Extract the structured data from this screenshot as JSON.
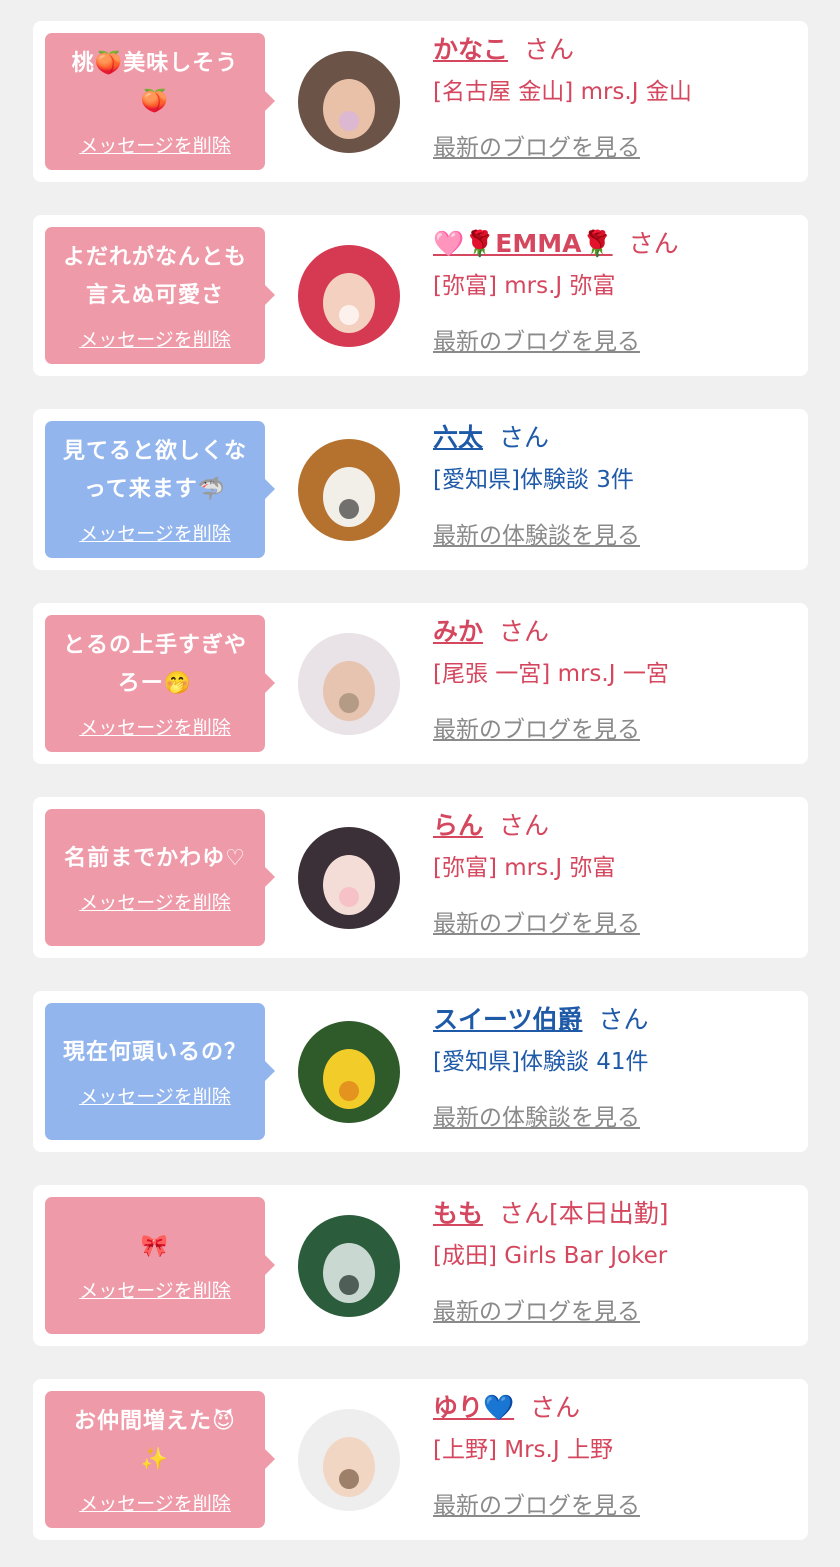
{
  "entries": [
    {
      "message": "桃🍑美味しそう\n🍑",
      "delete_label": "メッセージを削除",
      "name": "かなこ",
      "suffix": "さん",
      "subtitle": "[名古屋 金山] mrs.J 金山",
      "link_label": "最新のブログを見る",
      "variant": "pink",
      "avatar": {
        "bg": "#6b5347",
        "fg": "#e8c1a8",
        "accent": "#d9b3e6"
      }
    },
    {
      "message": "よだれがなんとも\n言えぬ可愛さ",
      "delete_label": "メッセージを削除",
      "name": "🩷🌹EMMA🌹",
      "suffix": "さん",
      "subtitle": "[弥富] mrs.J 弥富",
      "link_label": "最新のブログを見る",
      "variant": "pink",
      "avatar": {
        "bg": "#d63a52",
        "fg": "#f3d0c0",
        "accent": "#ffffff"
      }
    },
    {
      "message": "見てると欲しくな\nって来ます🦈",
      "delete_label": "メッセージを削除",
      "name": "六太",
      "suffix": "さん",
      "subtitle": "[愛知県]体験談 3件",
      "link_label": "最新の体験談を見る",
      "variant": "blue",
      "avatar": {
        "bg": "#b5722f",
        "fg": "#f2efe8",
        "accent": "#3a3a3a"
      }
    },
    {
      "message": "とるの上手すぎや\nろー🤭",
      "delete_label": "メッセージを削除",
      "name": "みか",
      "suffix": "さん",
      "subtitle": "[尾張 一宮] mrs.J 一宮",
      "link_label": "最新のブログを見る",
      "variant": "pink",
      "avatar": {
        "bg": "#e9e2e6",
        "fg": "#e7c4b0",
        "accent": "#9c8a74"
      }
    },
    {
      "message": "名前までかわゆ♡",
      "delete_label": "メッセージを削除",
      "name": "らん",
      "suffix": "さん",
      "subtitle": "[弥富] mrs.J 弥富",
      "link_label": "最新のブログを見る",
      "variant": "pink",
      "avatar": {
        "bg": "#3b3037",
        "fg": "#f4ddd6",
        "accent": "#f7b6c2"
      }
    },
    {
      "message": "現在何頭いるの？",
      "delete_label": "メッセージを削除",
      "name": "スイーツ伯爵",
      "suffix": "さん",
      "subtitle": "[愛知県]体験談 41件",
      "link_label": "最新の体験談を見る",
      "variant": "blue",
      "avatar": {
        "bg": "#2f5a2a",
        "fg": "#f2cd2a",
        "accent": "#e07b1b"
      }
    },
    {
      "message": "🎀",
      "delete_label": "メッセージを削除",
      "name": "もも",
      "suffix": "さん[本日出勤]",
      "subtitle": "[成田] Girls Bar Joker",
      "link_label": "最新のブログを見る",
      "variant": "pink",
      "avatar": {
        "bg": "#2b5c3c",
        "fg": "#c9d9d1",
        "accent": "#1b2a24"
      }
    },
    {
      "message": "お仲間増えた😈\n✨",
      "delete_label": "メッセージを削除",
      "name": "ゆり💙",
      "suffix": "さん",
      "subtitle": "[上野] Mrs.J 上野",
      "link_label": "最新のブログを見る",
      "variant": "pink",
      "avatar": {
        "bg": "#eeeeee",
        "fg": "#f2d6c4",
        "accent": "#7a5a44"
      }
    }
  ]
}
